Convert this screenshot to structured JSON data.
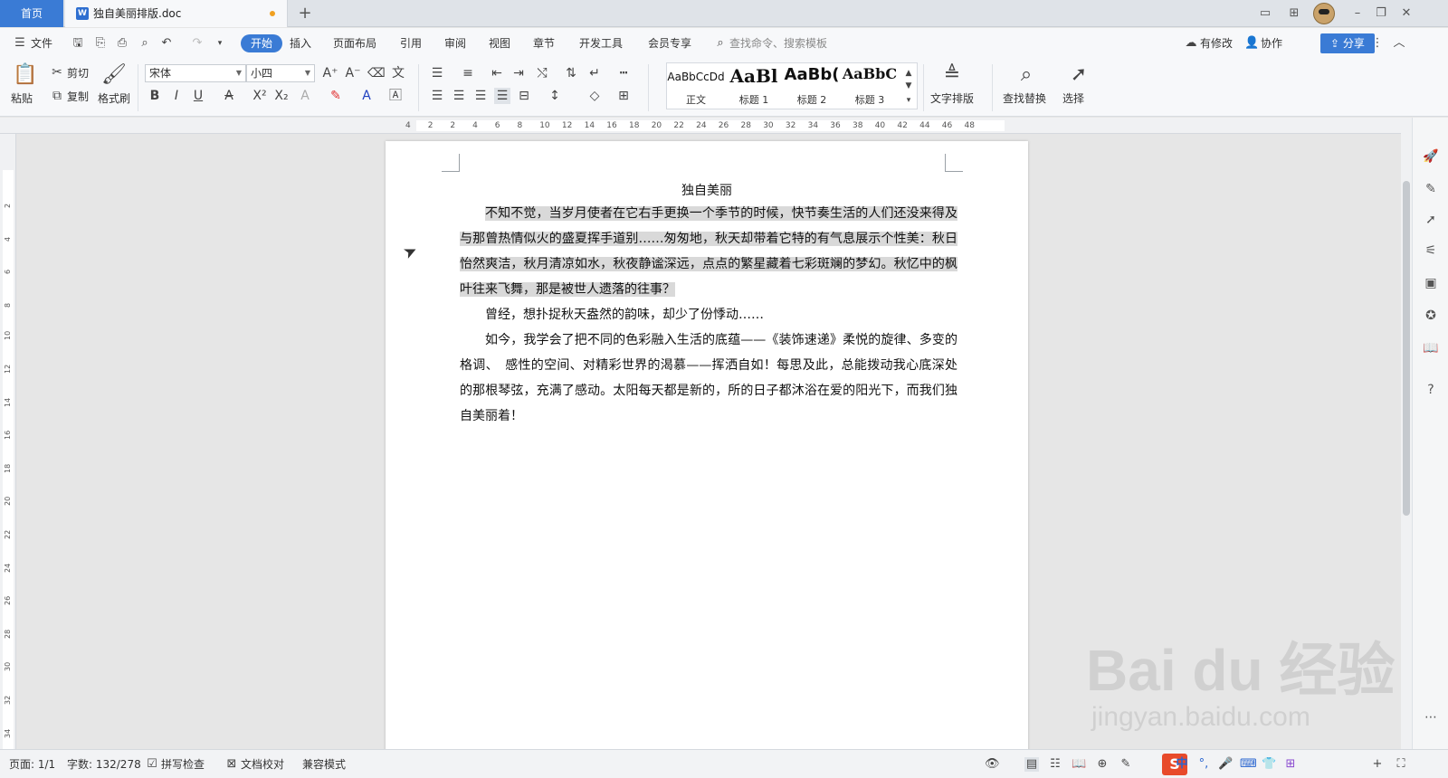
{
  "tabs": {
    "home": "首页",
    "doc_title": "独自美丽排版.doc",
    "add": "+"
  },
  "menu": {
    "file": "文件",
    "items": [
      "开始",
      "插入",
      "页面布局",
      "引用",
      "审阅",
      "视图",
      "章节",
      "开发工具",
      "会员专享"
    ],
    "search_placeholder": "查找命令、搜索模板",
    "modified": "有修改",
    "collab": "协作",
    "share": "分享"
  },
  "ribbon": {
    "paste": "粘贴",
    "cut": "剪切",
    "copy": "复制",
    "format_painter": "格式刷",
    "font_name": "宋体",
    "font_size": "小四",
    "styles": [
      {
        "sample": "AaBbCcDd",
        "name": "正文"
      },
      {
        "sample": "AaBl",
        "name": "标题 1"
      },
      {
        "sample": "AaBb(",
        "name": "标题 2"
      },
      {
        "sample": "AaBbC",
        "name": "标题 3"
      }
    ],
    "text_layout": "文字排版",
    "find_replace": "查找替换",
    "select": "选择"
  },
  "ruler": {
    "h_ticks": [
      "4",
      "2",
      "2",
      "4",
      "6",
      "8",
      "10",
      "12",
      "14",
      "16",
      "18",
      "20",
      "22",
      "24",
      "26",
      "28",
      "30",
      "32",
      "34",
      "36",
      "38",
      "40",
      "42",
      "44",
      "46",
      "48"
    ],
    "v_ticks": [
      "2",
      "4",
      "6",
      "8",
      "10",
      "12",
      "14",
      "16",
      "18",
      "20",
      "22",
      "24",
      "26",
      "28",
      "30",
      "32",
      "34"
    ]
  },
  "document": {
    "heading": "独自美丽",
    "para1": "不知不觉，当岁月使者在它右手更换一个季节的时候，快节奏生活的人们还没来得及与那曾热情似火的盛夏挥手道别……匆匆地，秋天却带着它特的有气息展示个性美：秋日怡然爽洁，秋月清凉如水，秋夜静谧深远，点点的繁星藏着七彩斑斓的梦幻。秋忆中的枫叶往来飞舞，那是被世人遗落的往事？",
    "para2": "曾经，想扑捉秋天盎然的韵味，却少了份悸动……",
    "para3": "如今，我学会了把不同的色彩融入生活的底蕴——《装饰速递》柔悦的旋律、多变的格调、　感性的空间、对精彩世界的渴慕——挥洒自如！每思及此，总能拨动我心底深处的那根琴弦，充满了感动。太阳每天都是新的，所的日子都沐浴在爱的阳光下，而我们独自美丽着！"
  },
  "status": {
    "page": "页面: 1/1",
    "words": "字数: 132/278",
    "spell": "拼写检查",
    "proof": "文档校对",
    "compat": "兼容模式"
  },
  "ime": {
    "logo": "S",
    "lang": "中"
  },
  "watermark": {
    "main": "Bai du 经验",
    "sub": "jingyan.baidu.com"
  }
}
